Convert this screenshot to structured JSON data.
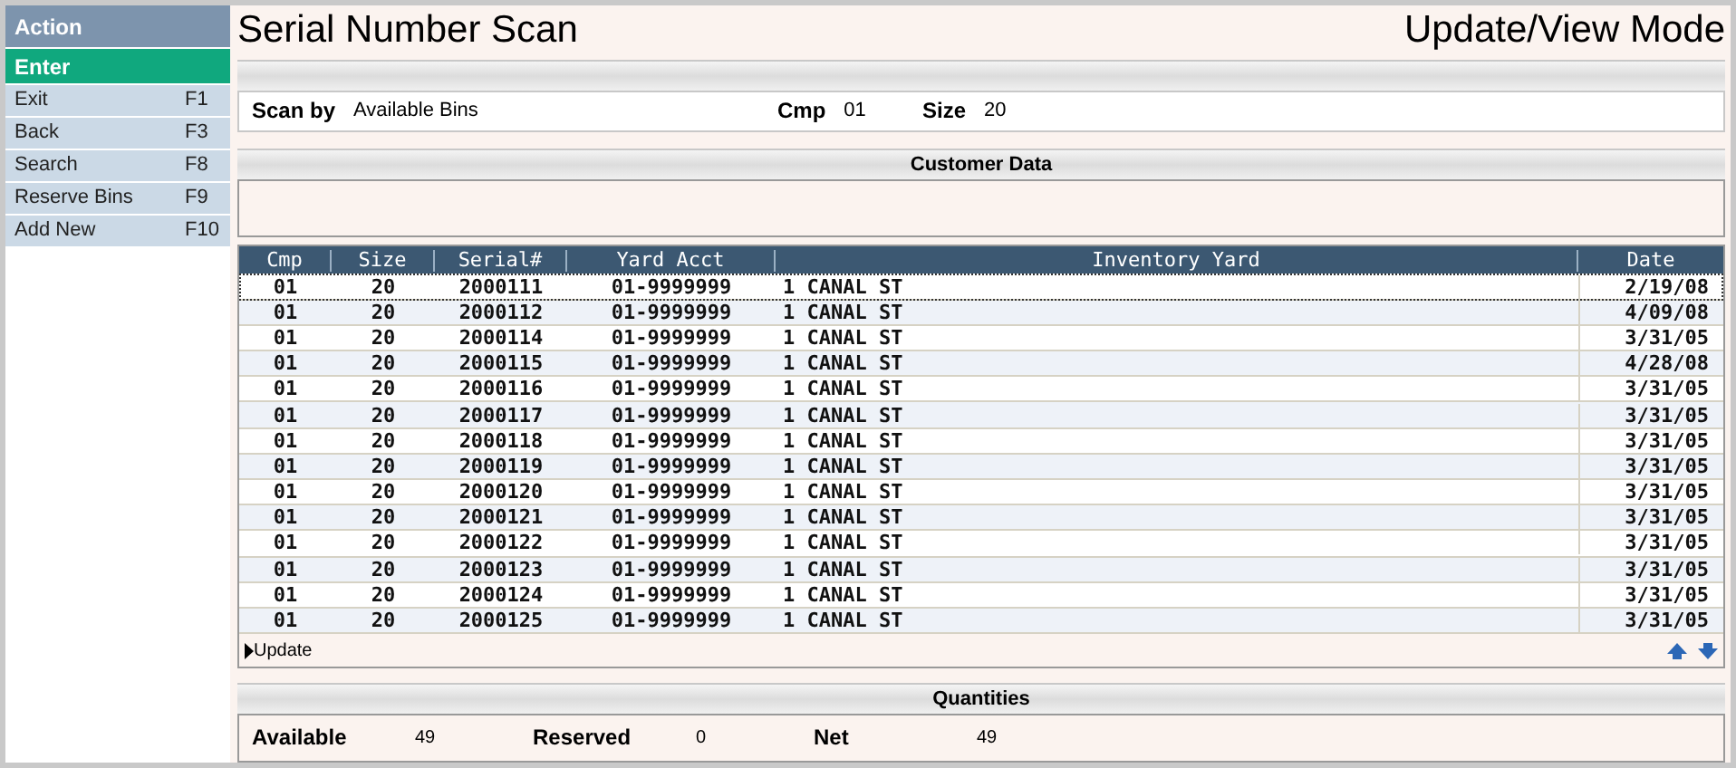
{
  "sidebar": {
    "title": "Action",
    "items": [
      {
        "label": "Enter",
        "selected": true
      },
      {
        "label": "Exit",
        "key": "F1",
        "selected": false
      },
      {
        "label": "Back",
        "key": "F3",
        "selected": false
      },
      {
        "label": "Search",
        "key": "F8",
        "selected": false
      },
      {
        "label": "Reserve Bins",
        "key": "F9",
        "selected": false
      },
      {
        "label": "Add New",
        "key": "F10",
        "selected": false
      }
    ]
  },
  "header": {
    "title": "Serial Number Scan",
    "mode": "Update/View Mode"
  },
  "scan": {
    "fields": [
      {
        "label": "Scan by",
        "value": "Available Bins"
      },
      {
        "label": "Cmp",
        "value": "01"
      },
      {
        "label": "Size",
        "value": "20"
      }
    ]
  },
  "customer": {
    "title": "Customer Data"
  },
  "table": {
    "columns": [
      "Cmp",
      "Size",
      "Serial#",
      "Yard Acct",
      "Inventory Yard",
      "Date"
    ],
    "rows": [
      {
        "cells": [
          "01",
          "20",
          "2000111",
          "01-9999999",
          "1 CANAL ST",
          "2/19/08"
        ],
        "selected": true
      },
      {
        "cells": [
          "01",
          "20",
          "2000112",
          "01-9999999",
          "1 CANAL ST",
          "4/09/08"
        ],
        "selected": false
      },
      {
        "cells": [
          "01",
          "20",
          "2000114",
          "01-9999999",
          "1 CANAL ST",
          "3/31/05"
        ],
        "selected": false
      },
      {
        "cells": [
          "01",
          "20",
          "2000115",
          "01-9999999",
          "1 CANAL ST",
          "4/28/08"
        ],
        "selected": false
      },
      {
        "cells": [
          "01",
          "20",
          "2000116",
          "01-9999999",
          "1 CANAL ST",
          "3/31/05"
        ],
        "selected": false
      },
      {
        "cells": [
          "01",
          "20",
          "2000117",
          "01-9999999",
          "1 CANAL ST",
          "3/31/05"
        ],
        "selected": false
      },
      {
        "cells": [
          "01",
          "20",
          "2000118",
          "01-9999999",
          "1 CANAL ST",
          "3/31/05"
        ],
        "selected": false
      },
      {
        "cells": [
          "01",
          "20",
          "2000119",
          "01-9999999",
          "1 CANAL ST",
          "3/31/05"
        ],
        "selected": false
      },
      {
        "cells": [
          "01",
          "20",
          "2000120",
          "01-9999999",
          "1 CANAL ST",
          "3/31/05"
        ],
        "selected": false
      },
      {
        "cells": [
          "01",
          "20",
          "2000121",
          "01-9999999",
          "1 CANAL ST",
          "3/31/05"
        ],
        "selected": false
      },
      {
        "cells": [
          "01",
          "20",
          "2000122",
          "01-9999999",
          "1 CANAL ST",
          "3/31/05"
        ],
        "selected": false
      },
      {
        "cells": [
          "01",
          "20",
          "2000123",
          "01-9999999",
          "1 CANAL ST",
          "3/31/05"
        ],
        "selected": false
      },
      {
        "cells": [
          "01",
          "20",
          "2000124",
          "01-9999999",
          "1 CANAL ST",
          "3/31/05"
        ],
        "selected": false
      },
      {
        "cells": [
          "01",
          "20",
          "2000125",
          "01-9999999",
          "1 CANAL ST",
          "3/31/05"
        ],
        "selected": false
      }
    ],
    "action": "Update"
  },
  "quantities": {
    "title": "Quantities",
    "fields": [
      {
        "label": "Available",
        "value": "49"
      },
      {
        "label": "Reserved",
        "value": "0"
      },
      {
        "label": "Net",
        "value": "49"
      }
    ]
  }
}
